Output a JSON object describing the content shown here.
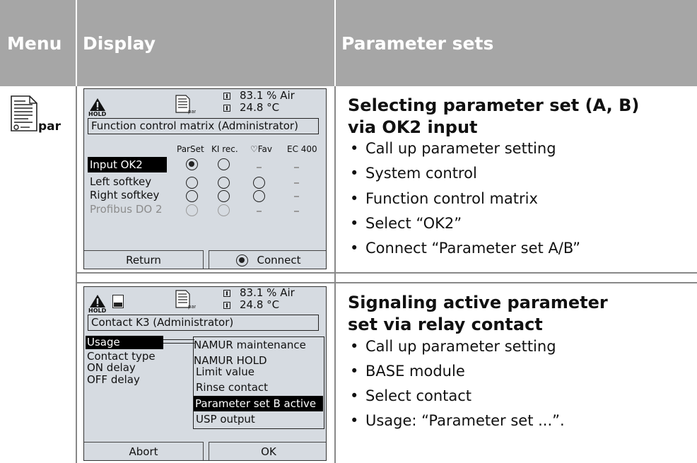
{
  "header": {
    "menu": "Menu",
    "display": "Display",
    "params": "Parameter sets"
  },
  "menu_icon": {
    "name": "parameter-document-icon",
    "label": "par"
  },
  "screen1": {
    "status": {
      "hold": "HOLD",
      "value1": "83.1 % Air",
      "value2": "24.8 °C"
    },
    "title": "Function control matrix (Administrator)",
    "columns": [
      "ParSet",
      "KI rec.",
      "♡Fav",
      "EC 400"
    ],
    "rows": [
      "Input OK2",
      "Left softkey",
      "Right softkey",
      "Profibus DO 2"
    ],
    "buttons": {
      "left": "Return",
      "right": "Connect"
    }
  },
  "screen2": {
    "status": {
      "hold": "HOLD",
      "value1": "83.1 % Air",
      "value2": "24.8 °C"
    },
    "title": "Contact K3 (Administrator)",
    "fields": [
      "Usage",
      "Contact type",
      "ON delay",
      "OFF delay"
    ],
    "options": [
      "NAMUR maintenance",
      "NAMUR HOLD",
      "Limit value",
      "Rinse contact",
      "Parameter set B active",
      "USP output"
    ],
    "buttons": {
      "left": "Abort",
      "right": "OK"
    }
  },
  "section1": {
    "heading_line1": "Selecting parameter set (A, B)",
    "heading_line2": "via OK2 input",
    "bullets": [
      "Call up parameter setting",
      "System control",
      "Function control matrix",
      "Select “OK2”",
      "Connect “Parameter set A/B”"
    ]
  },
  "section2": {
    "heading_line1": "Signaling active parameter",
    "heading_line2": "set via relay contact",
    "bullets": [
      "Call up parameter setting",
      "BASE module",
      "Select contact",
      "Usage: “Parameter set ...”."
    ]
  }
}
